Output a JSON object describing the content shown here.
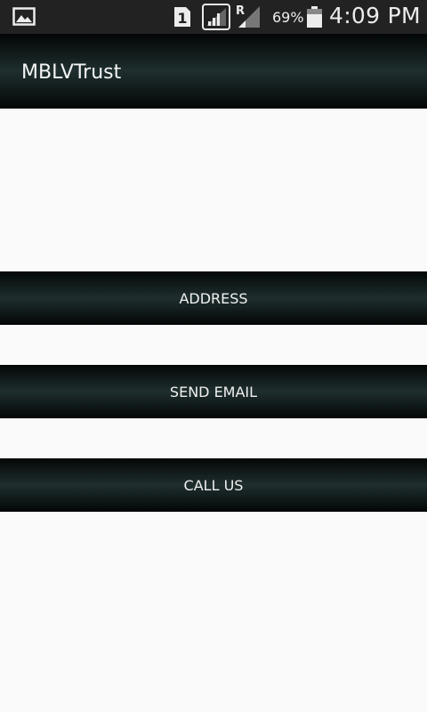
{
  "status_bar": {
    "battery_percent": "69%",
    "time": "4:09 PM",
    "sim_slot": "1",
    "roaming_indicator": "R",
    "icons": [
      "gallery-icon",
      "sim-card-icon",
      "signal-icon",
      "roaming-signal-icon",
      "battery-icon"
    ]
  },
  "action_bar": {
    "title": "MBLVTrust"
  },
  "buttons": {
    "address": "ADDRESS",
    "send_email": "SEND EMAIL",
    "call_us": "CALL US"
  },
  "colors": {
    "status_bar_bg": "#222222",
    "bar_gradient_dark": "#030606",
    "bar_gradient_mid": "#1f2e2e",
    "page_bg": "#fafafa",
    "text_light": "#f0f0f0"
  }
}
